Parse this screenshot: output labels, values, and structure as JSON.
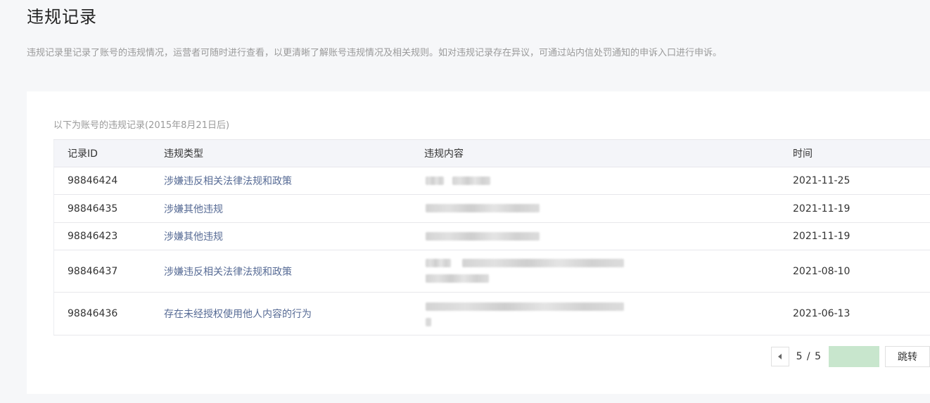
{
  "page": {
    "title": "违规记录",
    "description": "违规记录里记录了账号的违规情况，运营者可随时进行查看，以更清晰了解账号违规情况及相关规则。如对违规记录存在异议，可通过站内信处罚通知的申诉入口进行申诉。"
  },
  "table": {
    "caption": "以下为账号的违规记录(2015年8月21日后)",
    "headers": {
      "id": "记录ID",
      "type": "违规类型",
      "content": "违规内容",
      "time": "时间"
    },
    "rows": [
      {
        "id": "98846424",
        "type": "涉嫌违反相关法律法规和政策",
        "time": "2021-11-25"
      },
      {
        "id": "98846435",
        "type": "涉嫌其他违规",
        "time": "2021-11-19"
      },
      {
        "id": "98846423",
        "type": "涉嫌其他违规",
        "time": "2021-11-19"
      },
      {
        "id": "98846437",
        "type": "涉嫌违反相关法律法规和政策",
        "time": "2021-08-10"
      },
      {
        "id": "98846436",
        "type": "存在未经授权使用他人内容的行为",
        "time": "2021-06-13"
      }
    ]
  },
  "pager": {
    "page_indicator": "5 / 5",
    "input_value": "",
    "go_label": "跳转"
  },
  "colors": {
    "link": "#576b95",
    "pager_input_bg": "#c8e6cd"
  }
}
